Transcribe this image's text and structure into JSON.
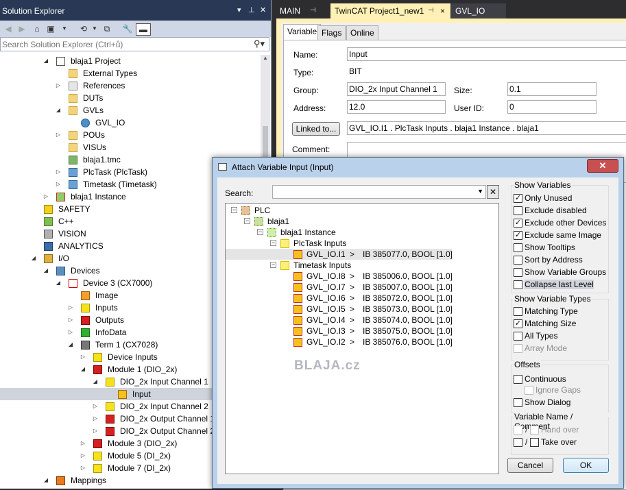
{
  "solution_explorer": {
    "title": "Solution Explorer",
    "search_placeholder": "Search Solution Explorer (Ctrl+ů)",
    "tree": [
      {
        "label": "blaja1 Project",
        "level": 1,
        "expander": "open",
        "icon": "project-icon"
      },
      {
        "label": "External Types",
        "level": 2,
        "expander": "",
        "icon": "folder-icon"
      },
      {
        "label": "References",
        "level": 2,
        "expander": "closed",
        "icon": "references-icon"
      },
      {
        "label": "DUTs",
        "level": 2,
        "expander": "",
        "icon": "folder-icon"
      },
      {
        "label": "GVLs",
        "level": 2,
        "expander": "open",
        "icon": "folder-icon"
      },
      {
        "label": "GVL_IO",
        "level": 3,
        "expander": "",
        "icon": "globe-icon"
      },
      {
        "label": "POUs",
        "level": 2,
        "expander": "closed",
        "icon": "folder-icon"
      },
      {
        "label": "VISUs",
        "level": 2,
        "expander": "",
        "icon": "folder-icon"
      },
      {
        "label": "blaja1.tmc",
        "level": 2,
        "expander": "",
        "icon": "tmc-file-icon"
      },
      {
        "label": "PlcTask (PlcTask)",
        "level": 2,
        "expander": "closed",
        "icon": "task-icon"
      },
      {
        "label": "Timetask (Timetask)",
        "level": 2,
        "expander": "closed",
        "icon": "task-icon"
      },
      {
        "label": "blaja1 Instance",
        "level": 1,
        "expander": "closed",
        "icon": "instance-icon"
      },
      {
        "label": "SAFETY",
        "level": 0,
        "expander": "",
        "icon": "safety-icon"
      },
      {
        "label": "C++",
        "level": 0,
        "expander": "",
        "icon": "cpp-icon"
      },
      {
        "label": "VISION",
        "level": 0,
        "expander": "",
        "icon": "vision-icon"
      },
      {
        "label": "ANALYTICS",
        "level": 0,
        "expander": "",
        "icon": "analytics-icon"
      },
      {
        "label": "I/O",
        "level": 0,
        "expander": "open",
        "icon": "io-icon"
      },
      {
        "label": "Devices",
        "level": 1,
        "expander": "open",
        "icon": "devices-icon"
      },
      {
        "label": "Device 3 (CX7000)",
        "level": 2,
        "expander": "open",
        "icon": "beckhoff-icon"
      },
      {
        "label": "Image",
        "level": 3,
        "expander": "",
        "icon": "image-icon"
      },
      {
        "label": "Inputs",
        "level": 3,
        "expander": "closed",
        "icon": "inputs-icon"
      },
      {
        "label": "Outputs",
        "level": 3,
        "expander": "closed",
        "icon": "outputs-icon"
      },
      {
        "label": "InfoData",
        "level": 3,
        "expander": "closed",
        "icon": "infodata-icon"
      },
      {
        "label": "Term 1 (CX7028)",
        "level": 3,
        "expander": "open",
        "icon": "terminal-icon"
      },
      {
        "label": "Device Inputs",
        "level": 4,
        "expander": "closed",
        "icon": "inputs-icon"
      },
      {
        "label": "Module 1 (DIO_2x)",
        "level": 4,
        "expander": "open",
        "icon": "module-icon"
      },
      {
        "label": "DIO_2x Input Channel 1",
        "level": 5,
        "expander": "open",
        "icon": "inputs-icon"
      },
      {
        "label": "Input",
        "level": 6,
        "expander": "",
        "icon": "variable-input-icon",
        "selected": true
      },
      {
        "label": "DIO_2x Input Channel 2",
        "level": 5,
        "expander": "closed",
        "icon": "inputs-icon"
      },
      {
        "label": "DIO_2x Output Channel 1",
        "level": 5,
        "expander": "closed",
        "icon": "outputs-icon"
      },
      {
        "label": "DIO_2x Output Channel 2",
        "level": 5,
        "expander": "closed",
        "icon": "outputs-icon"
      },
      {
        "label": "Module 3 (DIO_2x)",
        "level": 4,
        "expander": "closed",
        "icon": "module-icon"
      },
      {
        "label": "Module 5 (DI_2x)",
        "level": 4,
        "expander": "closed",
        "icon": "module-yellow-icon"
      },
      {
        "label": "Module 7 (DI_2x)",
        "level": 4,
        "expander": "closed",
        "icon": "module-yellow-icon"
      },
      {
        "label": "Mappings",
        "level": 1,
        "expander": "open",
        "icon": "mappings-icon"
      }
    ]
  },
  "doc_tabs": [
    {
      "label": "MAIN",
      "pin": "⊣",
      "active": false
    },
    {
      "label": "TwinCAT Project1_new1",
      "pin": "⊣",
      "close": "×",
      "active": true
    },
    {
      "label": "GVL_IO",
      "active": false
    }
  ],
  "variable_panel": {
    "tabs": [
      "Variable",
      "Flags",
      "Online"
    ],
    "name_label": "Name:",
    "name_value": "Input",
    "type_label": "Type:",
    "type_value": "BIT",
    "group_label": "Group:",
    "group_value": "DIO_2x Input Channel 1",
    "size_label": "Size:",
    "size_value": "0.1",
    "address_label": "Address:",
    "address_value": "12.0",
    "userid_label": "User ID:",
    "userid_value": "0",
    "linked_button": "Linked to...",
    "linked_value": "GVL_IO.I1 . PlcTask Inputs . blaja1 Instance . blaja1",
    "comment_label": "Comment:"
  },
  "dialog": {
    "title": "Attach Variable Input (Input)",
    "search_label": "Search:",
    "search_value": "",
    "clear_symbol": "✕",
    "tree": [
      {
        "label": "PLC",
        "level": 0,
        "exp": "⊟",
        "icon": "plc-icon"
      },
      {
        "label": "blaja1",
        "level": 1,
        "exp": "⊟",
        "icon": "plc-project-icon"
      },
      {
        "label": "blaja1 Instance",
        "level": 2,
        "exp": "⊟",
        "icon": "instance-icon"
      },
      {
        "label": "PlcTask Inputs",
        "level": 3,
        "exp": "⊟",
        "icon": "folder-inputs-icon"
      },
      {
        "label": "GVL_IO.I1",
        "level": 4,
        "exp": "",
        "icon": "variable-icon",
        "gt": ">",
        "type": "IB 385077.0, BOOL [1.0]",
        "selected": true
      },
      {
        "label": "Timetask Inputs",
        "level": 3,
        "exp": "⊟",
        "icon": "folder-inputs-icon"
      },
      {
        "label": "GVL_IO.I8",
        "level": 4,
        "exp": "",
        "icon": "variable-icon",
        "gt": ">",
        "type": "IB 385006.0, BOOL [1.0]"
      },
      {
        "label": "GVL_IO.I7",
        "level": 4,
        "exp": "",
        "icon": "variable-icon",
        "gt": ">",
        "type": "IB 385007.0, BOOL [1.0]"
      },
      {
        "label": "GVL_IO.I6",
        "level": 4,
        "exp": "",
        "icon": "variable-icon",
        "gt": ">",
        "type": "IB 385072.0, BOOL [1.0]"
      },
      {
        "label": "GVL_IO.I5",
        "level": 4,
        "exp": "",
        "icon": "variable-icon",
        "gt": ">",
        "type": "IB 385073.0, BOOL [1.0]"
      },
      {
        "label": "GVL_IO.I4",
        "level": 4,
        "exp": "",
        "icon": "variable-icon",
        "gt": ">",
        "type": "IB 385074.0, BOOL [1.0]"
      },
      {
        "label": "GVL_IO.I3",
        "level": 4,
        "exp": "",
        "icon": "variable-icon",
        "gt": ">",
        "type": "IB 385075.0, BOOL [1.0]"
      },
      {
        "label": "GVL_IO.I2",
        "level": 4,
        "exp": "",
        "icon": "variable-icon",
        "gt": ">",
        "type": "IB 385076.0, BOOL [1.0]"
      }
    ],
    "watermark": "BLAJA.cz",
    "show_variables": {
      "title": "Show Variables",
      "items": [
        {
          "label": "Only Unused",
          "checked": true
        },
        {
          "label": "Exclude disabled",
          "checked": false
        },
        {
          "label": "Exclude other Devices",
          "checked": true
        },
        {
          "label": "Exclude same Image",
          "checked": true
        },
        {
          "label": "Show Tooltips",
          "checked": false
        },
        {
          "label": "Sort by Address",
          "checked": false
        },
        {
          "label": "Show Variable Groups",
          "checked": false
        },
        {
          "label": "Collapse last Level",
          "checked": false
        }
      ]
    },
    "show_variable_types": {
      "title": "Show Variable Types",
      "items": [
        {
          "label": "Matching Type",
          "checked": false
        },
        {
          "label": "Matching Size",
          "checked": true
        },
        {
          "label": "All Types",
          "checked": false
        },
        {
          "label": "Array Mode",
          "checked": false,
          "disabled": true
        }
      ]
    },
    "offsets": {
      "title": "Offsets",
      "continuous": "Continuous",
      "ignore_gaps": "Ignore Gaps",
      "show_dialog": "Show Dialog"
    },
    "name_comment": {
      "title": "Variable Name / Comment",
      "hand_over": "Hand over",
      "take_over": "Take over",
      "sep": "/"
    },
    "cancel": "Cancel",
    "ok": "OK"
  },
  "colors": {
    "title_bar": "#293955",
    "doc_tab_active": "#fff1b6",
    "dialog_frame": "#b9d1ea",
    "close_button": "#c75050",
    "selection": "#cfd3dc"
  }
}
